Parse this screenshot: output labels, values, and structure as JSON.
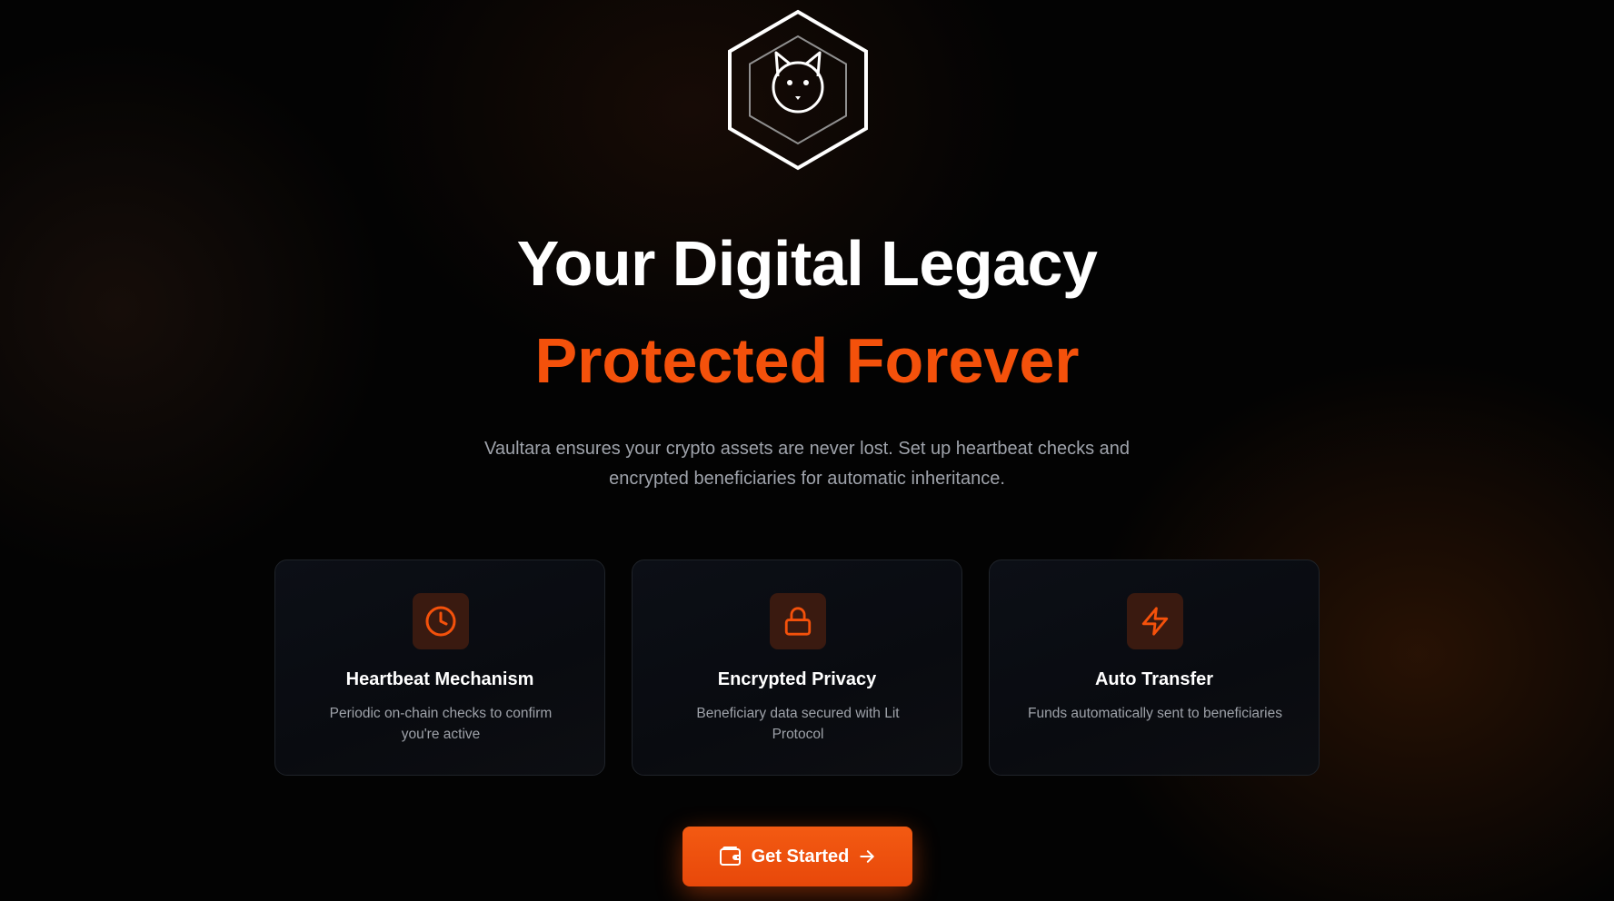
{
  "hero": {
    "logo_icon": "hexagon-cat-logo-icon",
    "title": "Your Digital Legacy",
    "subtitle": "Protected Forever",
    "description": "Vaultara ensures your crypto assets are never lost. Set up heartbeat checks and encrypted beneficiaries for automatic inheritance."
  },
  "features": [
    {
      "icon": "clock-icon",
      "title": "Heartbeat Mechanism",
      "description": "Periodic on-chain checks to confirm you're active"
    },
    {
      "icon": "lock-icon",
      "title": "Encrypted Privacy",
      "description": "Beneficiary data secured with Lit Protocol"
    },
    {
      "icon": "lightning-icon",
      "title": "Auto Transfer",
      "description": "Funds automatically sent to beneficiaries"
    }
  ],
  "cta": {
    "label": "Get Started",
    "leading_icon": "wallet-icon",
    "trailing_icon": "arrow-right-icon"
  },
  "colors": {
    "accent": "#f4510b",
    "background": "#030303",
    "card_background": "#0b0e14",
    "icon_tile": "#3a1a10",
    "text_primary": "#ffffff",
    "text_muted": "#9fa3ab"
  }
}
